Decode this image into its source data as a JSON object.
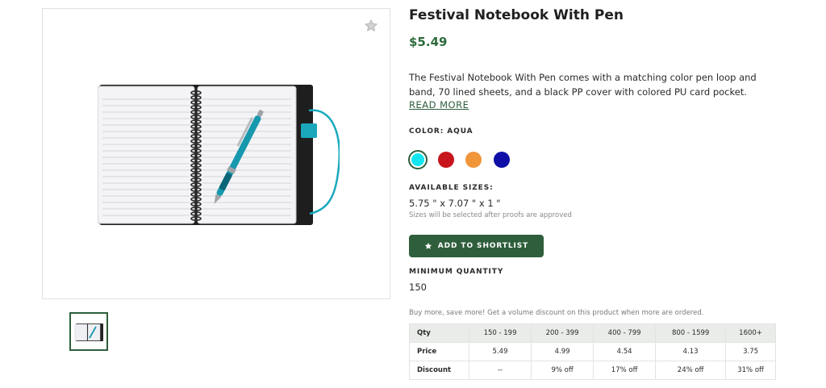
{
  "product": {
    "title": "Festival Notebook With Pen",
    "price": "$5.49",
    "description": "The Festival Notebook With Pen comes with a matching color pen loop and band, 70 lined sheets, and a black PP cover with colored PU card pocket.",
    "read_more": "READ MORE"
  },
  "color": {
    "label": "COLOR: AQUA",
    "swatches": [
      {
        "name": "aqua",
        "hex": "#13e6f0",
        "selected": true
      },
      {
        "name": "red",
        "hex": "#c8141c",
        "selected": false
      },
      {
        "name": "orange",
        "hex": "#f0953a",
        "selected": false
      },
      {
        "name": "blue",
        "hex": "#0f0fa8",
        "selected": false
      }
    ]
  },
  "sizes": {
    "label": "AVAILABLE SIZES:",
    "value": "5.75 \" x 7.07 \" x 1 \"",
    "note": "Sizes will be selected after proofs are approved"
  },
  "actions": {
    "shortlist_label": "ADD TO SHORTLIST"
  },
  "minimum": {
    "label": "MINIMUM QUANTITY",
    "value": "150"
  },
  "pricing": {
    "promo": "Buy more, save more! Get a volume discount on this product when more are ordered.",
    "headers": [
      "Qty",
      "150 - 199",
      "200 - 399",
      "400 - 799",
      "800 - 1599",
      "1600+"
    ],
    "price_row": [
      "Price",
      "5.49",
      "4.99",
      "4.54",
      "4.13",
      "3.75"
    ],
    "discount_row": [
      "Discount",
      "--",
      "9% off",
      "17% off",
      "24% off",
      "31% off"
    ]
  },
  "icons": {
    "favorite": "star-icon",
    "shortlist": "star-icon"
  },
  "colors": {
    "brand_green": "#2e5e3b",
    "price_green": "#2e6b3c",
    "table_header_bg": "#e9ece9"
  }
}
